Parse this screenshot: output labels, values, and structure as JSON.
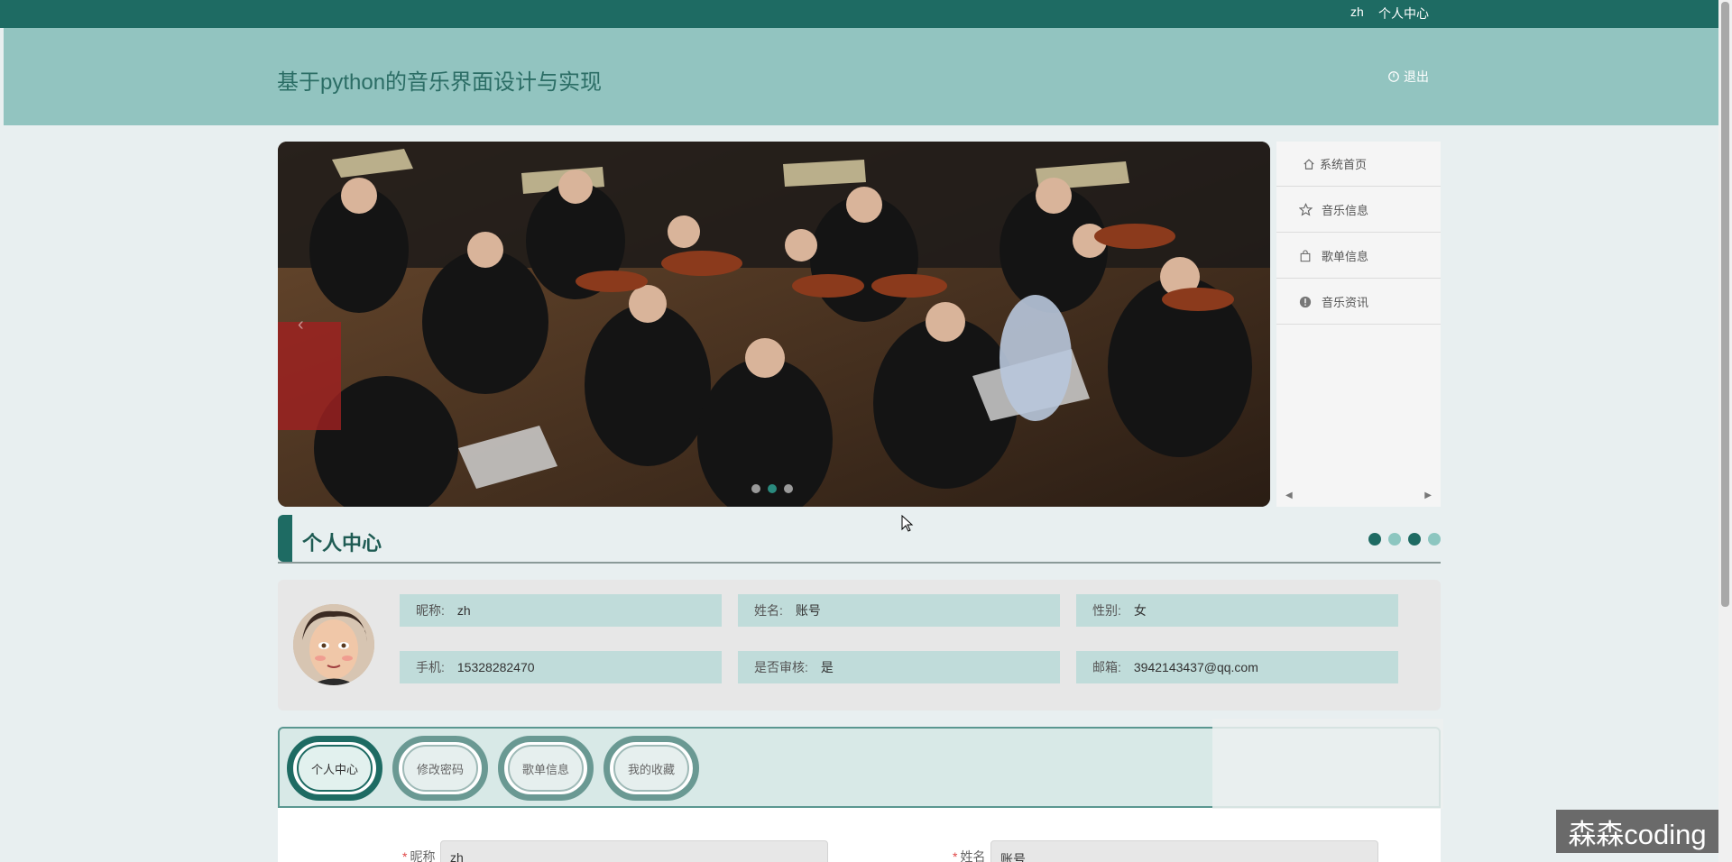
{
  "topbar": {
    "user": "zh",
    "personal_center": "个人中心"
  },
  "header": {
    "title": "基于python的音乐界面设计与实现",
    "logout": "退出"
  },
  "carousel": {
    "prev_icon": "‹",
    "dots": 3,
    "active_dot": 1
  },
  "sidenav": {
    "items": [
      {
        "label": "系统首页",
        "icon": "home-icon"
      },
      {
        "label": "音乐信息",
        "icon": "star-icon"
      },
      {
        "label": "歌单信息",
        "icon": "bag-icon"
      },
      {
        "label": "音乐资讯",
        "icon": "info-icon"
      }
    ]
  },
  "section": {
    "title": "个人中心",
    "dot_colors": [
      "#1e6b63",
      "#8cc6c0",
      "#1e6b63",
      "#8cc6c0"
    ]
  },
  "profile": {
    "fields": [
      {
        "key": "昵称:",
        "value": "zh"
      },
      {
        "key": "姓名:",
        "value": "账号"
      },
      {
        "key": "性别:",
        "value": "女"
      },
      {
        "key": "手机:",
        "value": "15328282470"
      },
      {
        "key": "是否审核:",
        "value": "是"
      },
      {
        "key": "邮箱:",
        "value": "3942143437@qq.com"
      }
    ]
  },
  "tabs": [
    {
      "label": "个人中心",
      "active": true
    },
    {
      "label": "修改密码",
      "active": false
    },
    {
      "label": "歌单信息",
      "active": false
    },
    {
      "label": "我的收藏",
      "active": false
    }
  ],
  "form": {
    "nickname": {
      "label": "昵称",
      "value": "zh"
    },
    "name": {
      "label": "姓名",
      "value": "账号"
    }
  },
  "watermark": "森森coding",
  "colors": {
    "primary": "#1e6b63",
    "header_bg": "#92c4c0",
    "field_bg": "#c0dcda"
  }
}
